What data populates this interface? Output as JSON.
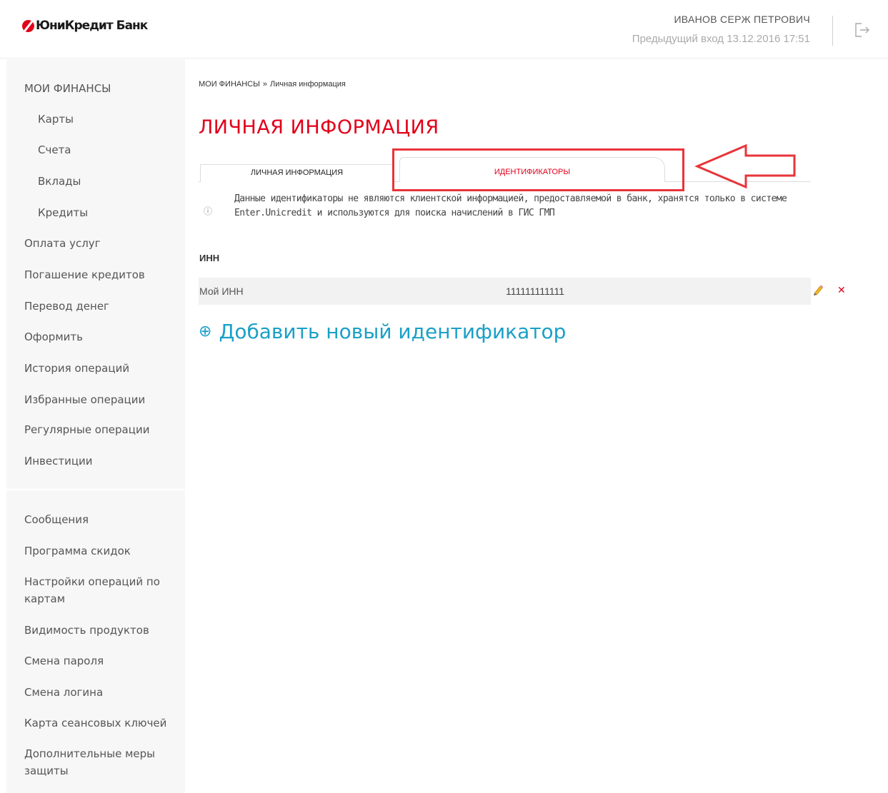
{
  "header": {
    "logo_text": "ЮниКредит Банк",
    "user_name": "ИВАНОВ СЕРЖ ПЕТРОВИЧ",
    "last_login": "Предыдущий вход 13.12.2016 17:51"
  },
  "sidebar": {
    "section_title": "МОИ ФИНАНСЫ",
    "sub_items": [
      "Карты",
      "Счета",
      "Вклады",
      "Кредиты"
    ],
    "items": [
      "Оплата услуг",
      "Погашение кредитов",
      "Перевод денег",
      "Оформить",
      "История операций",
      "Избранные операции",
      "Регулярные операции",
      "Инвестиции"
    ],
    "items_secondary": [
      "Сообщения",
      "Программа скидок",
      "Настройки операций по картам",
      "Видимость продуктов",
      "Смена пароля",
      "Смена логина",
      "Карта сеансовых ключей",
      "Дополнительные меры защиты"
    ]
  },
  "breadcrumb": {
    "root": "МОИ ФИНАНСЫ",
    "separator": "»",
    "current": "Личная информация"
  },
  "page_title": "ЛИЧНАЯ ИНФОРМАЦИЯ",
  "tabs": [
    {
      "label": "ЛИЧНАЯ ИНФОРМАЦИЯ",
      "active": false
    },
    {
      "label": "ИДЕНТИФИКАТОРЫ",
      "active": true
    }
  ],
  "info": {
    "icon": "info-circle-icon",
    "text": "Данные идентификаторы не являются клиентской информацией, предоставляемой в банк, хранятся только в системе Enter.Unicredit и используются для поиска начислений в ГИС ГМП"
  },
  "inn_section": {
    "heading": "ИНН",
    "rows": [
      {
        "label": "Мой ИНН",
        "value": "111111111111"
      }
    ]
  },
  "add_link": {
    "icon": "⊕",
    "label": "Добавить новый идентификатор"
  },
  "colors": {
    "brand_red": "#e2001a",
    "link_blue": "#1aa0c7",
    "annotation_red": "#e8343a"
  }
}
